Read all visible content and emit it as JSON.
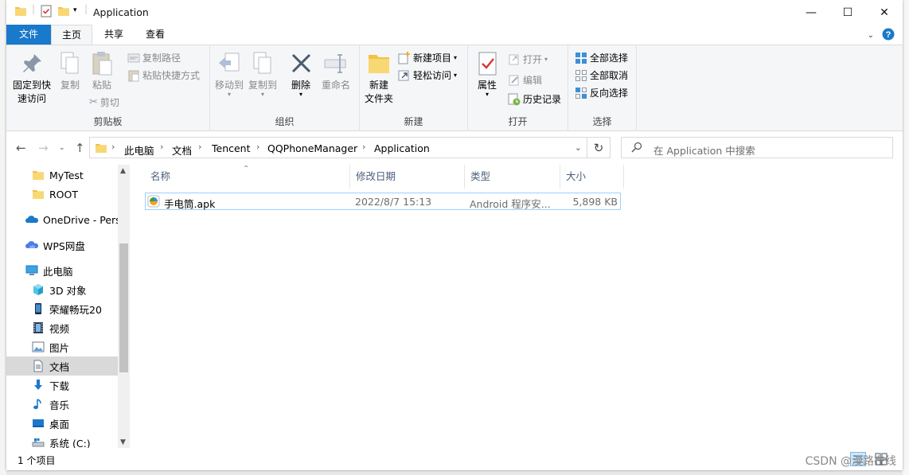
{
  "window": {
    "title": "Application"
  },
  "window_controls": {
    "minimize": "—",
    "maximize": "☐",
    "close": "✕"
  },
  "ribbon_tabs": {
    "file": "文件",
    "home": "主页",
    "share": "共享",
    "view": "查看"
  },
  "ribbon": {
    "clipboard": {
      "label": "剪贴板",
      "pin": "固定到快\n速访问",
      "copy": "复制",
      "paste": "粘贴",
      "copy_path": "复制路径",
      "paste_shortcut": "粘贴快捷方式",
      "cut": "剪切"
    },
    "organize": {
      "label": "组织",
      "move_to": "移动到",
      "copy_to": "复制到",
      "delete": "删除",
      "rename": "重命名"
    },
    "new": {
      "label": "新建",
      "new_folder": "新建\n文件夹",
      "new_item": "新建项目",
      "easy_access": "轻松访问"
    },
    "open": {
      "label": "打开",
      "properties": "属性",
      "open": "打开",
      "edit": "编辑",
      "history": "历史记录"
    },
    "select": {
      "label": "选择",
      "select_all": "全部选择",
      "select_none": "全部取消",
      "invert": "反向选择"
    }
  },
  "address": {
    "crumbs": [
      "此电脑",
      "文档",
      "Tencent",
      "QQPhoneManager",
      "Application"
    ]
  },
  "search": {
    "placeholder": "在 Application 中搜索"
  },
  "nav_pane": {
    "items": [
      {
        "label": "MyTest",
        "icon": "folder-icon"
      },
      {
        "label": "ROOT",
        "icon": "folder-icon"
      },
      {
        "label": "OneDrive - Perso",
        "icon": "onedrive-icon"
      },
      {
        "label": "WPS网盘",
        "icon": "wps-cloud-icon"
      },
      {
        "label": "此电脑",
        "icon": "this-pc-icon"
      },
      {
        "label": "3D 对象",
        "icon": "3d-objects-icon"
      },
      {
        "label": "荣耀畅玩20",
        "icon": "phone-icon"
      },
      {
        "label": "视频",
        "icon": "video-icon"
      },
      {
        "label": "图片",
        "icon": "pictures-icon"
      },
      {
        "label": "文档",
        "icon": "documents-icon"
      },
      {
        "label": "下载",
        "icon": "downloads-icon"
      },
      {
        "label": "音乐",
        "icon": "music-icon"
      },
      {
        "label": "桌面",
        "icon": "desktop-icon"
      },
      {
        "label": "系统 (C:)",
        "icon": "drive-icon"
      }
    ]
  },
  "file_list": {
    "columns": {
      "name": "名称",
      "modified": "修改日期",
      "type": "类型",
      "size": "大小"
    },
    "rows": [
      {
        "name": "手电筒.apk",
        "modified": "2022/8/7 15:13",
        "type": "Android 程序安...",
        "size": "5,898 KB"
      }
    ]
  },
  "status": {
    "item_count": "1 个项目"
  },
  "watermark": "CSDN @漫路在线",
  "colors": {
    "accent": "#1979ca",
    "folder": "#f3c242",
    "selection": "#cce8ff"
  }
}
